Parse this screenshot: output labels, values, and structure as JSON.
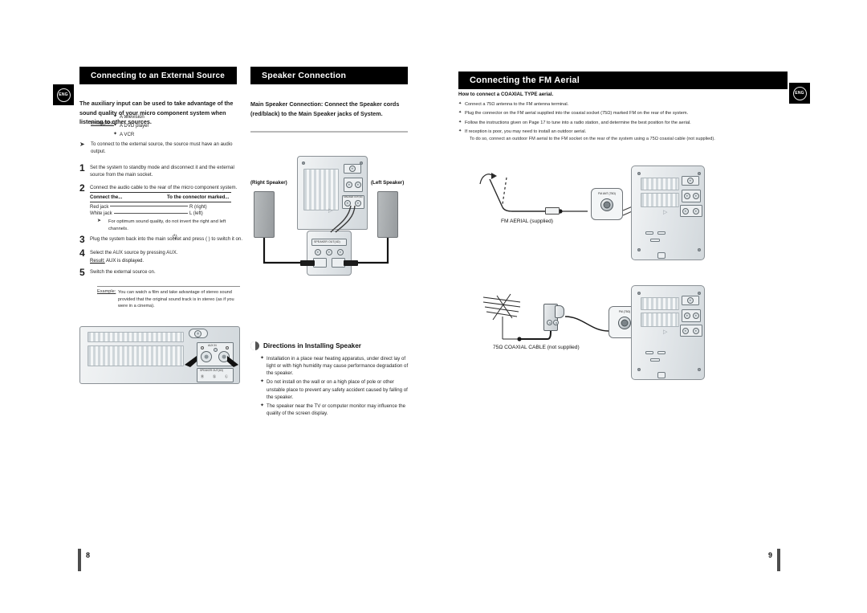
{
  "document": {
    "language_badge": "ENG",
    "left_page_number": "8",
    "right_page_number": "9"
  },
  "left_page": {
    "section1": {
      "title": "Connecting to an External Source",
      "lead": "The auxiliary input can be used to take advantage of the sound quality of your micro component system when listening to other sources.",
      "examples_label": "Examples:",
      "examples": [
        "A television",
        "A DVD player",
        "A VCR"
      ],
      "note": "To connect to  the external source, the source must have an audio output.",
      "steps": [
        {
          "num": "1",
          "text": "Set the system to standby mode and disconnect it and the external source from the main socket."
        },
        {
          "num": "2",
          "text": "Connect the audio cable to the rear of the micro component system."
        },
        {
          "num": "3",
          "text": "Plug the system back into the main socket and press (      ) to switch it on."
        },
        {
          "num": "4",
          "text": "Select the AUX source by pressing AUX."
        },
        {
          "num": "5",
          "text": "Switch the external source on."
        }
      ],
      "step4_result_label": "Result:",
      "step4_result_text": "AUX is displayed.",
      "table": {
        "header_left": "Connect the...",
        "header_right": "To the connector marked...",
        "rows": [
          {
            "label": "Red jack",
            "value": "R (right)"
          },
          {
            "label": "White jack",
            "value": "L (left)"
          }
        ]
      },
      "inline_note": "For optimum sound quality, do not invert the right and left channels.",
      "example_label": "Example:",
      "example_text": "You can watch a film and take advantage of stereo sound provided that the original sound track is in stereo (as if you were in a cinema)."
    },
    "rear_panel_diagram": {
      "name": "rear-panel-aux-detail",
      "labels": {
        "aux_in": "AUX IN",
        "speaker_out": "SPEAKER  OUT(4Ω)"
      }
    }
  },
  "middle_page": {
    "section2": {
      "title": "Speaker Connection",
      "lead": "Main Speaker Connection: Connect the Speaker cords (red/black) to the Main Speaker jacks of System."
    },
    "speaker_diagram": {
      "right_speaker_label": "(Right Speaker)",
      "left_speaker_label": "(Left Speaker)",
      "terminal_label": "SPEAKER  OUT(4Ω)",
      "terminal_marks": [
        "R",
        "L"
      ]
    },
    "directions": {
      "title": "Directions in Installing Speaker",
      "bullets": [
        "Installation in a place near heating apparatus, under direct lay of light or with high humidity may cause performance degradation of the speaker.",
        "Do not install on the wall or on a high place of pole or other unstable place to prevent any safety accident caused by falling of the speaker.",
        " The speaker near the TV or computer monitor may influence the quality of the screen display."
      ]
    }
  },
  "right_page": {
    "section3": {
      "title": "Connecting the FM Aerial",
      "subtitle": "How to connect a COAXIAL TYPE aerial.",
      "bullets": [
        "Connect a 75Ω antenna to the FM antenna terminal.",
        "Plug the connector on the FM aerial supplied into the coaxial socket (75Ω) marked FM on the rear of the system.",
        "Follow the instructions given on Page 17 to tune into a radio station, and determine the best position for the aerial.",
        "If reception is poor, you may need to install an outdoor aerial."
      ],
      "bullet4_continuation": "To do so, connect an outdoor FM aerial to the FM socket on the rear of the system using a 75Ω coaxial cable (not supplied)."
    },
    "diagram_top": {
      "label": "FM AERIAL (supplied)",
      "callout_label": "FM ANT (75Ω)"
    },
    "diagram_bottom": {
      "label": "75Ω COAXIAL CABLE (not supplied)",
      "callout_label": "FM (75Ω)"
    }
  }
}
